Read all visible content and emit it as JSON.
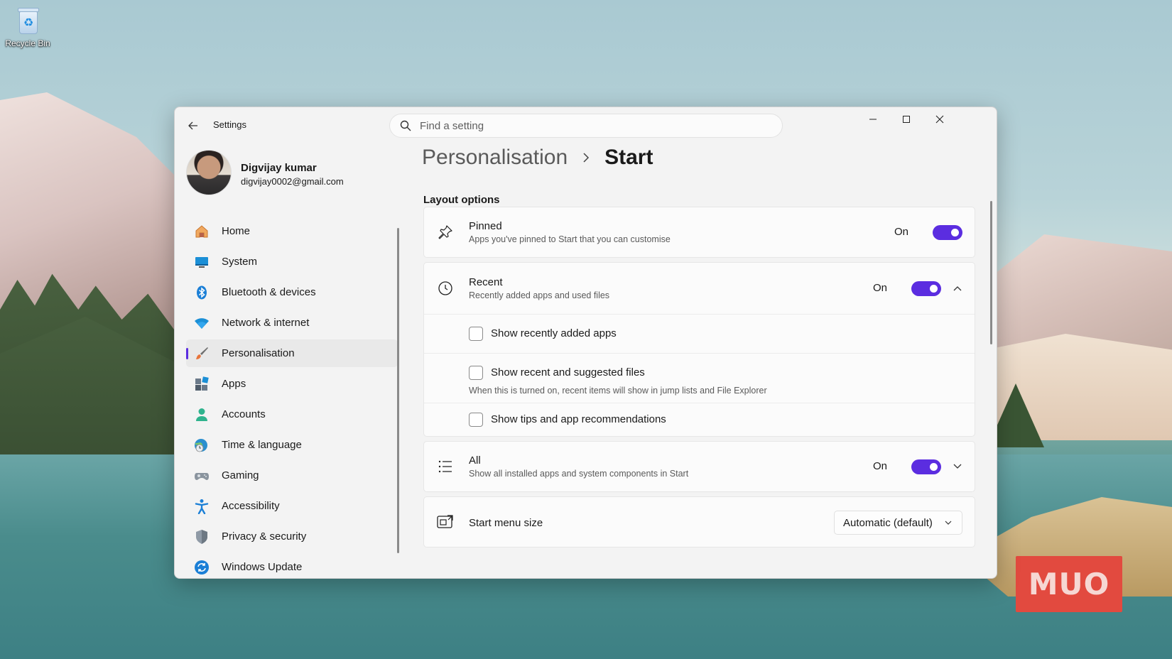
{
  "desktop": {
    "recycle_bin_label": "Recycle Bin",
    "watermark": "MUO"
  },
  "window": {
    "app_title": "Settings",
    "search_placeholder": "Find a setting"
  },
  "profile": {
    "name": "Digvijay kumar",
    "email": "digvijay0002@gmail.com"
  },
  "sidebar": {
    "active": "Personalisation",
    "items": [
      {
        "label": "Home",
        "icon": "home-icon"
      },
      {
        "label": "System",
        "icon": "system-icon"
      },
      {
        "label": "Bluetooth & devices",
        "icon": "bluetooth-icon"
      },
      {
        "label": "Network & internet",
        "icon": "wifi-icon"
      },
      {
        "label": "Personalisation",
        "icon": "brush-icon"
      },
      {
        "label": "Apps",
        "icon": "apps-icon"
      },
      {
        "label": "Accounts",
        "icon": "accounts-icon"
      },
      {
        "label": "Time & language",
        "icon": "globe-clock-icon"
      },
      {
        "label": "Gaming",
        "icon": "gamepad-icon"
      },
      {
        "label": "Accessibility",
        "icon": "accessibility-icon"
      },
      {
        "label": "Privacy & security",
        "icon": "shield-icon"
      },
      {
        "label": "Windows Update",
        "icon": "update-icon"
      }
    ]
  },
  "main": {
    "breadcrumb_parent": "Personalisation",
    "breadcrumb_current": "Start",
    "section_title": "Layout options",
    "pinned": {
      "title": "Pinned",
      "subtitle": "Apps you've pinned to Start that you can customise",
      "state": "On"
    },
    "recent": {
      "title": "Recent",
      "subtitle": "Recently added apps and used files",
      "state": "On",
      "options": [
        {
          "label": "Show recently added apps",
          "checked": false
        },
        {
          "label": "Show recent and suggested files",
          "checked": false,
          "note": "When this is turned on, recent items will show in jump lists and File Explorer"
        },
        {
          "label": "Show tips and app recommendations",
          "checked": false
        }
      ]
    },
    "all": {
      "title": "All",
      "subtitle": "Show all installed apps and system components in Start",
      "state": "On"
    },
    "menu_size": {
      "title": "Start menu size",
      "value": "Automatic (default)"
    }
  },
  "colors": {
    "accent": "#5b2de0"
  }
}
